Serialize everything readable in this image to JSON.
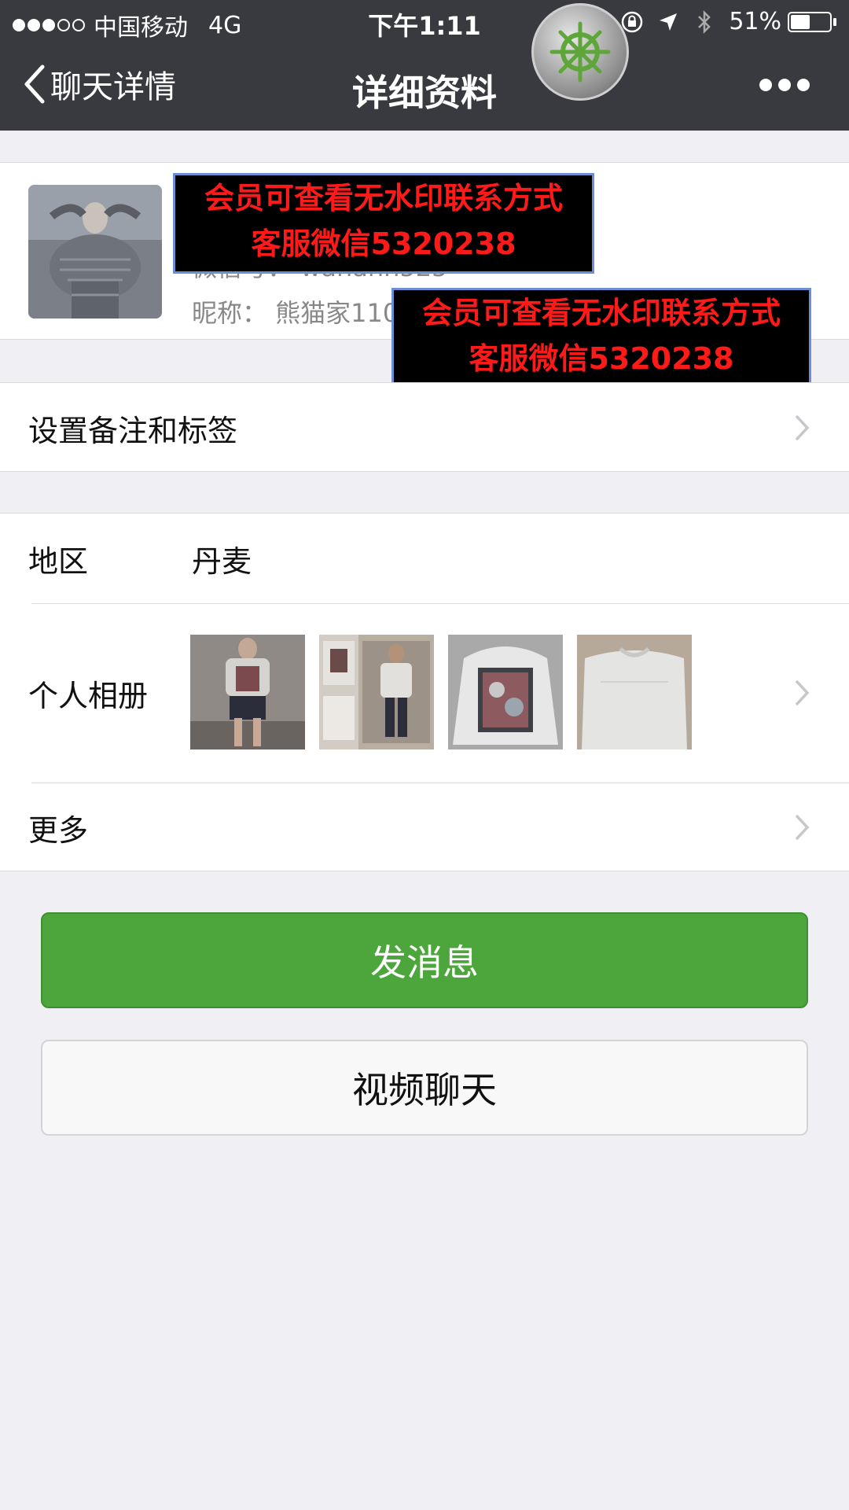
{
  "status_bar": {
    "carrier": "中国移动",
    "network": "4G",
    "time": "下午1:11",
    "battery": "51%",
    "battery_level": 0.51
  },
  "nav": {
    "back_label": "聊天详情",
    "title": "详细资料"
  },
  "profile": {
    "name": "",
    "wechat_id": "微信号： wanann525",
    "nickname": "昵称： 熊猫家110"
  },
  "watermarks": [
    {
      "line1": "会员可查看无水印联系方式",
      "line2": "客服微信5320238"
    },
    {
      "line1": "会员可查看无水印联系方式",
      "line2": "客服微信5320238"
    }
  ],
  "rows": {
    "remark_label": "设置备注和标签",
    "region_label": "地区",
    "region_value": "丹麦",
    "album_label": "个人相册",
    "more_label": "更多"
  },
  "buttons": {
    "send": "发消息",
    "video": "视频聊天"
  },
  "colors": {
    "nav_bg": "#393a3f",
    "page_bg": "#efeff4",
    "primary_green": "#4ca63c"
  }
}
